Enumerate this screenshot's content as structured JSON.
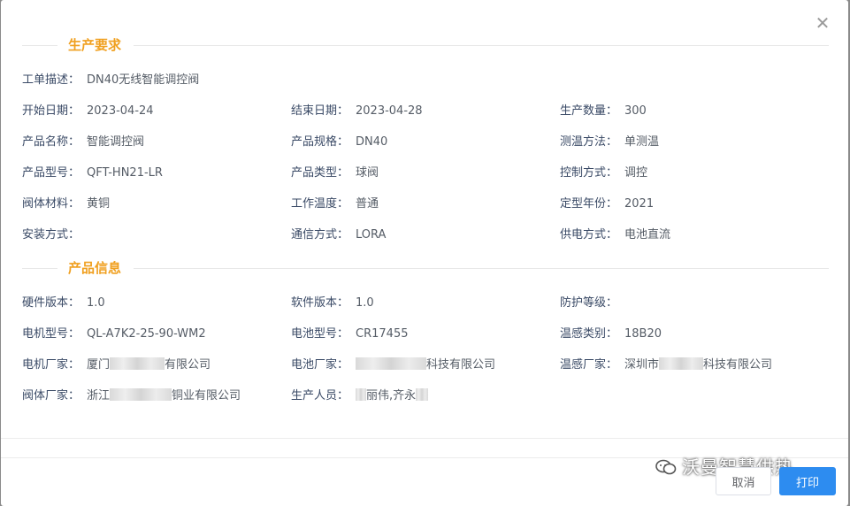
{
  "dialog": {
    "close_icon": "close-icon",
    "sections": {
      "production": {
        "title": "生产要求"
      },
      "product": {
        "title": "产品信息"
      }
    },
    "fields": {
      "work_order_desc": {
        "label": "工单描述：",
        "value": "DN40无线智能调控阀"
      },
      "start_date": {
        "label": "开始日期：",
        "value": "2023-04-24"
      },
      "end_date": {
        "label": "结束日期：",
        "value": "2023-04-28"
      },
      "quantity": {
        "label": "生产数量：",
        "value": "300"
      },
      "product_name": {
        "label": "产品名称：",
        "value": "智能调控阀"
      },
      "product_spec": {
        "label": "产品规格：",
        "value": "DN40"
      },
      "temp_method": {
        "label": "测温方法：",
        "value": "单测温"
      },
      "product_model": {
        "label": "产品型号：",
        "value": "QFT-HN21-LR"
      },
      "product_type": {
        "label": "产品类型：",
        "value": "球阀"
      },
      "control_mode": {
        "label": "控制方式：",
        "value": "调控"
      },
      "valve_material": {
        "label": "阀体材料：",
        "value": "黄铜"
      },
      "work_temp": {
        "label": "工作温度：",
        "value": "普通"
      },
      "model_year": {
        "label": "定型年份：",
        "value": "2021"
      },
      "install_mode": {
        "label": "安装方式：",
        "value": ""
      },
      "comm_mode": {
        "label": "通信方式：",
        "value": "LORA"
      },
      "power_mode": {
        "label": "供电方式：",
        "value": "电池直流"
      },
      "hw_version": {
        "label": "硬件版本：",
        "value": "1.0"
      },
      "sw_version": {
        "label": "软件版本：",
        "value": "1.0"
      },
      "protection": {
        "label": "防护等级：",
        "value": ""
      },
      "motor_model": {
        "label": "电机型号：",
        "value": "QL-A7K2-25-90-WM2"
      },
      "battery_model": {
        "label": "电池型号：",
        "value": "CR17455"
      },
      "sensor_type": {
        "label": "温感类别：",
        "value": "18B20"
      },
      "motor_vendor": {
        "label": "电机厂家：",
        "value_pre": "厦门",
        "value_post": "有限公司"
      },
      "battery_vendor": {
        "label": "电池厂家：",
        "value_pre": "",
        "value_post": "科技有限公司"
      },
      "sensor_vendor": {
        "label": "温感厂家：",
        "value_pre": "深圳市",
        "value_post": "科技有限公司"
      },
      "valve_vendor": {
        "label": "阀体厂家：",
        "value_pre": "浙江",
        "value_post": "铜业有限公司"
      },
      "producers": {
        "label": "生产人员：",
        "value_pre": "",
        "value_post": "丽伟,齐永"
      }
    }
  },
  "footer": {
    "watermark": "沃曼智慧供热",
    "cancel_label": "取消",
    "print_label": "打印"
  },
  "colors": {
    "section_title": "#f0a020",
    "label": "#3a4a66",
    "value": "#555c66",
    "primary": "#2d8cf0"
  }
}
